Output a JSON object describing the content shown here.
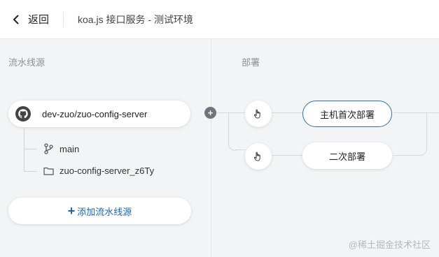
{
  "header": {
    "back_label": "返回",
    "title": "koa.js 接口服务 - 测试环境"
  },
  "sources": {
    "section_label": "流水线源",
    "repo": "dev-zuo/zuo-config-server",
    "branch": "main",
    "artifact": "zuo-config-server_z6Ty",
    "add_label": "添加流水线源"
  },
  "deploy": {
    "section_label": "部署",
    "stages": [
      {
        "label": "主机首次部署"
      },
      {
        "label": "二次部署"
      }
    ]
  },
  "watermark": "@稀土掘金技术社区",
  "colors": {
    "accent": "#1a66b3",
    "active_border": "#2f6fb0",
    "background": "#f3f4f5"
  }
}
